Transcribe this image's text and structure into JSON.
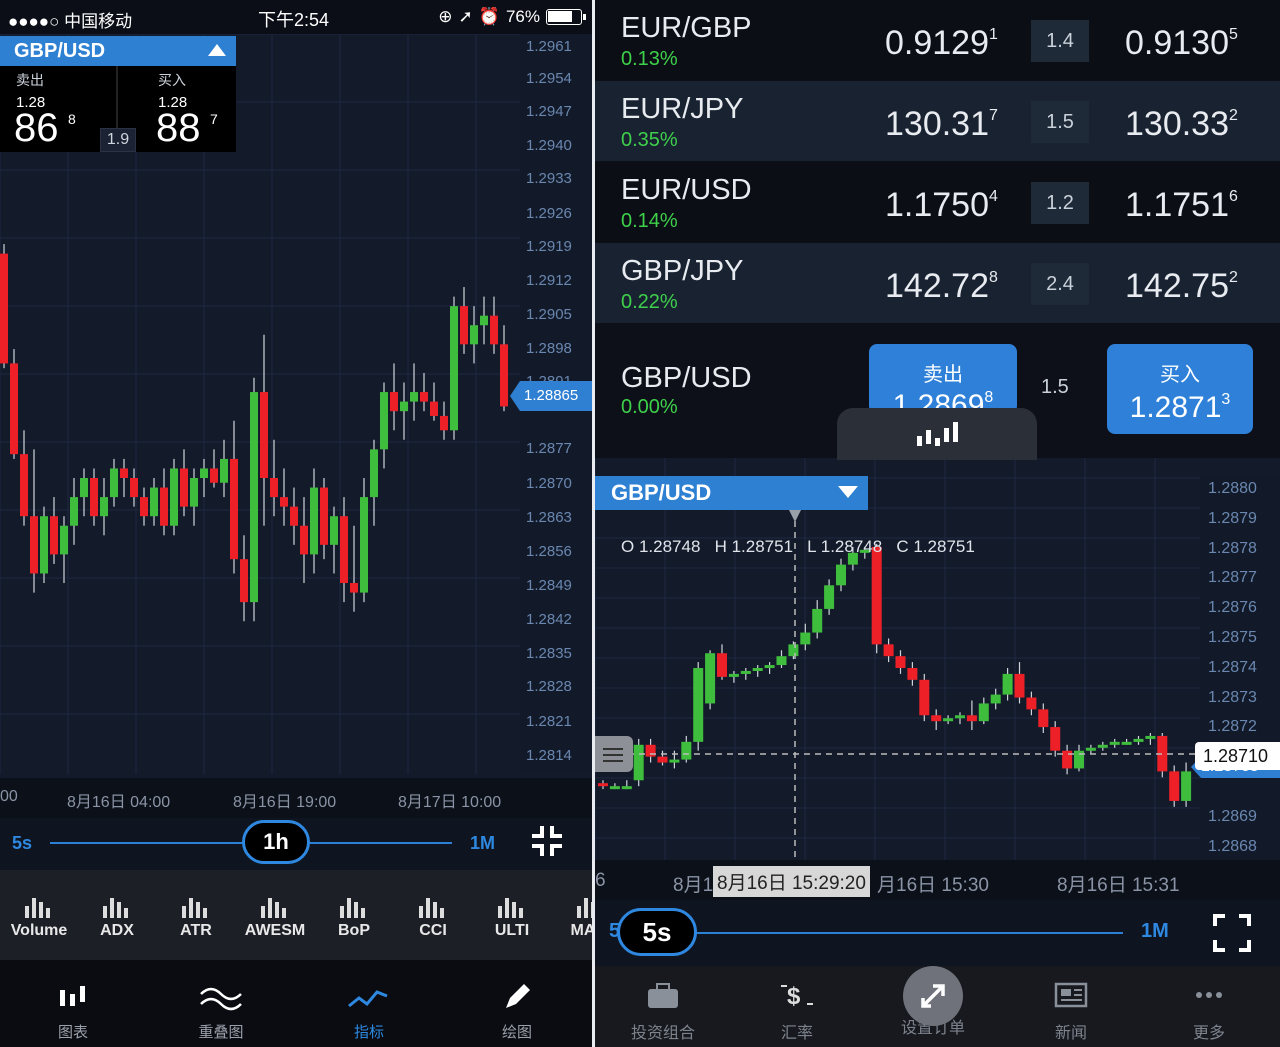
{
  "status": {
    "carrier": "●●●●○ 中国移动",
    "time": "下午2:54",
    "battery": "76%"
  },
  "left": {
    "pair": "GBP/USD",
    "sell": {
      "label": "卖出",
      "prefix": "1.28",
      "big": "86",
      "sup": "8"
    },
    "buy": {
      "label": "买入",
      "prefix": "1.28",
      "big": "88",
      "sup": "7"
    },
    "spread": "1.9",
    "price_ticks": [
      "1.2961",
      "1.2954",
      "1.2947",
      "1.2940",
      "1.2933",
      "1.2926",
      "1.2919",
      "1.2912",
      "1.2905",
      "1.2898",
      "1.2891",
      "1.2877",
      "1.2870",
      "1.2863",
      "1.2856",
      "1.2849",
      "1.2842",
      "1.2835",
      "1.2828",
      "1.2821",
      "1.2814"
    ],
    "current_price": "1.28865",
    "time_labels": [
      "00",
      "8月16日 04:00",
      "8月16日 19:00",
      "8月17日 10:00"
    ],
    "slider": {
      "min": "5s",
      "selected": "1h",
      "max": "1M"
    },
    "indicators": [
      "Volume",
      "ADX",
      "ATR",
      "AWESM",
      "BoP",
      "CCI",
      "ULTI",
      "MACI"
    ],
    "tabs": [
      "图表",
      "重叠图",
      "指标",
      "绘图"
    ],
    "chart_data": {
      "type": "candlestick",
      "ylim": [
        1.281,
        1.2965
      ],
      "ohlc": [
        [
          1.2919,
          1.2921,
          1.2895,
          1.2896
        ],
        [
          1.2896,
          1.2899,
          1.2876,
          1.2877
        ],
        [
          1.2877,
          1.2882,
          1.2862,
          1.2864
        ],
        [
          1.2864,
          1.2878,
          1.2848,
          1.2852
        ],
        [
          1.2852,
          1.2866,
          1.285,
          1.2864
        ],
        [
          1.2864,
          1.2868,
          1.2854,
          1.2856
        ],
        [
          1.2856,
          1.2864,
          1.285,
          1.2862
        ],
        [
          1.2862,
          1.2872,
          1.2858,
          1.2868
        ],
        [
          1.2868,
          1.2874,
          1.2864,
          1.2872
        ],
        [
          1.2872,
          1.2874,
          1.2862,
          1.2864
        ],
        [
          1.2864,
          1.2872,
          1.286,
          1.2868
        ],
        [
          1.2868,
          1.2876,
          1.2866,
          1.2874
        ],
        [
          1.2874,
          1.2876,
          1.2868,
          1.2872
        ],
        [
          1.2872,
          1.2874,
          1.2866,
          1.2868
        ],
        [
          1.2868,
          1.287,
          1.2862,
          1.2864
        ],
        [
          1.2864,
          1.2872,
          1.2862,
          1.287
        ],
        [
          1.287,
          1.2874,
          1.286,
          1.2862
        ],
        [
          1.2862,
          1.2876,
          1.286,
          1.2874
        ],
        [
          1.2874,
          1.2878,
          1.2864,
          1.2866
        ],
        [
          1.2866,
          1.2874,
          1.2862,
          1.2872
        ],
        [
          1.2872,
          1.2876,
          1.2868,
          1.2874
        ],
        [
          1.2874,
          1.2878,
          1.287,
          1.2871
        ],
        [
          1.2871,
          1.288,
          1.2868,
          1.2876
        ],
        [
          1.2876,
          1.2884,
          1.2852,
          1.2855
        ],
        [
          1.2855,
          1.286,
          1.2842,
          1.2846
        ],
        [
          1.2846,
          1.2893,
          1.2842,
          1.289
        ],
        [
          1.289,
          1.2902,
          1.2862,
          1.2872
        ],
        [
          1.2872,
          1.288,
          1.2864,
          1.2868
        ],
        [
          1.2868,
          1.2874,
          1.2862,
          1.2866
        ],
        [
          1.2866,
          1.287,
          1.2858,
          1.2862
        ],
        [
          1.2862,
          1.2868,
          1.285,
          1.2856
        ],
        [
          1.2856,
          1.2874,
          1.2852,
          1.287
        ],
        [
          1.287,
          1.2872,
          1.2855,
          1.2858
        ],
        [
          1.2858,
          1.2866,
          1.2852,
          1.2864
        ],
        [
          1.2864,
          1.2868,
          1.2846,
          1.285
        ],
        [
          1.285,
          1.2862,
          1.2844,
          1.2848
        ],
        [
          1.2848,
          1.2872,
          1.2846,
          1.2868
        ],
        [
          1.2868,
          1.288,
          1.2862,
          1.2878
        ],
        [
          1.2878,
          1.2892,
          1.2874,
          1.289
        ],
        [
          1.289,
          1.2896,
          1.2882,
          1.2886
        ],
        [
          1.2886,
          1.2892,
          1.288,
          1.2888
        ],
        [
          1.2888,
          1.2896,
          1.2884,
          1.289
        ],
        [
          1.289,
          1.2894,
          1.2886,
          1.2888
        ],
        [
          1.2888,
          1.2892,
          1.2884,
          1.2885
        ],
        [
          1.2885,
          1.2888,
          1.288,
          1.2882
        ],
        [
          1.2882,
          1.291,
          1.288,
          1.2908
        ],
        [
          1.2908,
          1.2912,
          1.2898,
          1.29
        ],
        [
          1.29,
          1.2908,
          1.2896,
          1.2904
        ],
        [
          1.2904,
          1.291,
          1.29,
          1.2906
        ],
        [
          1.2906,
          1.291,
          1.2898,
          1.29
        ],
        [
          1.29,
          1.2904,
          1.2886,
          1.2887
        ]
      ]
    }
  },
  "watchlist": [
    {
      "sym": "EUR/GBP",
      "chg": "0.13%",
      "bid": "0.9129",
      "bid_sup": "1",
      "spread": "1.4",
      "ask": "0.9130",
      "ask_sup": "5"
    },
    {
      "sym": "EUR/JPY",
      "chg": "0.35%",
      "bid": "130.31",
      "bid_sup": "7",
      "spread": "1.5",
      "ask": "130.33",
      "ask_sup": "2"
    },
    {
      "sym": "EUR/USD",
      "chg": "0.14%",
      "bid": "1.1750",
      "bid_sup": "4",
      "spread": "1.2",
      "ask": "1.1751",
      "ask_sup": "6"
    },
    {
      "sym": "GBP/JPY",
      "chg": "0.22%",
      "bid": "142.72",
      "bid_sup": "8",
      "spread": "2.4",
      "ask": "142.75",
      "ask_sup": "2"
    }
  ],
  "selected": {
    "sym": "GBP/USD",
    "chg": "0.00%",
    "sell_label": "卖出",
    "sell_price": "1.2869",
    "sell_sup": "8",
    "spread": "1.5",
    "buy_label": "买入",
    "buy_price": "1.2871",
    "buy_sup": "3"
  },
  "right": {
    "pair": "GBP/USD",
    "ohlc_text": "O 1.28748   H 1.28751   L 1.28748   C 1.28751",
    "price_ticks": [
      "1.2880",
      "1.2879",
      "1.2878",
      "1.2877",
      "1.2876",
      "1.2875",
      "1.2874",
      "1.2873",
      "1.2872",
      "1.2871",
      "1.2870",
      "1.2869",
      "1.2868"
    ],
    "current_price": "1.28710",
    "current_price_under": "1.28705",
    "time_labels": [
      "6",
      "8月1",
      "8月16日 15:29:20",
      "月16日 15:30",
      "8月16日 15:31"
    ],
    "slider": {
      "min": "5",
      "selected": "5s",
      "max": "1M"
    },
    "tabs": [
      "投资组合",
      "汇率",
      "设置订单",
      "新闻",
      "更多"
    ],
    "chart_data": {
      "type": "candlestick",
      "ylim": [
        1.28675,
        1.28805
      ],
      "ohlc": [
        [
          1.28701,
          1.28702,
          1.28699,
          1.287
        ],
        [
          1.287,
          1.28701,
          1.28699,
          1.287
        ],
        [
          1.287,
          1.28702,
          1.28699,
          1.287
        ],
        [
          1.28702,
          1.28716,
          1.287,
          1.28714
        ],
        [
          1.28714,
          1.28716,
          1.28708,
          1.2871
        ],
        [
          1.2871,
          1.28712,
          1.28707,
          1.28708
        ],
        [
          1.28708,
          1.28712,
          1.28706,
          1.28709
        ],
        [
          1.28709,
          1.28717,
          1.28708,
          1.28715
        ],
        [
          1.28715,
          1.28742,
          1.28712,
          1.2874
        ],
        [
          1.28728,
          1.28746,
          1.28726,
          1.28745
        ],
        [
          1.28745,
          1.28748,
          1.28736,
          1.28737
        ],
        [
          1.28737,
          1.28739,
          1.28735,
          1.28738
        ],
        [
          1.28738,
          1.2874,
          1.28736,
          1.28739
        ],
        [
          1.28739,
          1.28741,
          1.28737,
          1.2874
        ],
        [
          1.2874,
          1.28742,
          1.28738,
          1.28741
        ],
        [
          1.28741,
          1.28746,
          1.2874,
          1.28744
        ],
        [
          1.28744,
          1.28749,
          1.28743,
          1.28748
        ],
        [
          1.28748,
          1.28755,
          1.28746,
          1.28752
        ],
        [
          1.28752,
          1.28763,
          1.2875,
          1.2876
        ],
        [
          1.2876,
          1.2877,
          1.28758,
          1.28768
        ],
        [
          1.28768,
          1.28777,
          1.28766,
          1.28775
        ],
        [
          1.28775,
          1.28781,
          1.28773,
          1.28779
        ],
        [
          1.28779,
          1.28781,
          1.28777,
          1.2878
        ],
        [
          1.28781,
          1.28782,
          1.28745,
          1.28748
        ],
        [
          1.28748,
          1.2875,
          1.28742,
          1.28744
        ],
        [
          1.28744,
          1.28746,
          1.28738,
          1.2874
        ],
        [
          1.2874,
          1.28742,
          1.28734,
          1.28736
        ],
        [
          1.28736,
          1.28738,
          1.28722,
          1.28724
        ],
        [
          1.28724,
          1.28726,
          1.28719,
          1.28722
        ],
        [
          1.28722,
          1.28724,
          1.28721,
          1.28723
        ],
        [
          1.28723,
          1.28725,
          1.28721,
          1.28724
        ],
        [
          1.28724,
          1.28729,
          1.28719,
          1.28722
        ],
        [
          1.28722,
          1.2873,
          1.28721,
          1.28728
        ],
        [
          1.28728,
          1.28733,
          1.28726,
          1.28731
        ],
        [
          1.28731,
          1.2874,
          1.28729,
          1.28738
        ],
        [
          1.28738,
          1.28742,
          1.28728,
          1.2873
        ],
        [
          1.2873,
          1.28732,
          1.28724,
          1.28726
        ],
        [
          1.28726,
          1.28728,
          1.28718,
          1.2872
        ],
        [
          1.2872,
          1.28722,
          1.2871,
          1.28712
        ],
        [
          1.28712,
          1.28714,
          1.28704,
          1.28706
        ],
        [
          1.28706,
          1.28714,
          1.28705,
          1.28712
        ],
        [
          1.28712,
          1.28714,
          1.28711,
          1.28713
        ],
        [
          1.28713,
          1.28715,
          1.28712,
          1.28714
        ],
        [
          1.28714,
          1.28716,
          1.28713,
          1.28715
        ],
        [
          1.28715,
          1.28716,
          1.28714,
          1.28715
        ],
        [
          1.28715,
          1.28717,
          1.28714,
          1.28716
        ],
        [
          1.28716,
          1.28718,
          1.28714,
          1.28717
        ],
        [
          1.28717,
          1.28718,
          1.28703,
          1.28705
        ],
        [
          1.28705,
          1.28707,
          1.28693,
          1.28695
        ],
        [
          1.28695,
          1.28708,
          1.28693,
          1.28705
        ]
      ]
    }
  },
  "colors": {
    "bull": "#3fbd3c",
    "bear": "#ee2027",
    "accent": "#2e80d3",
    "panel": "#131b2b"
  }
}
